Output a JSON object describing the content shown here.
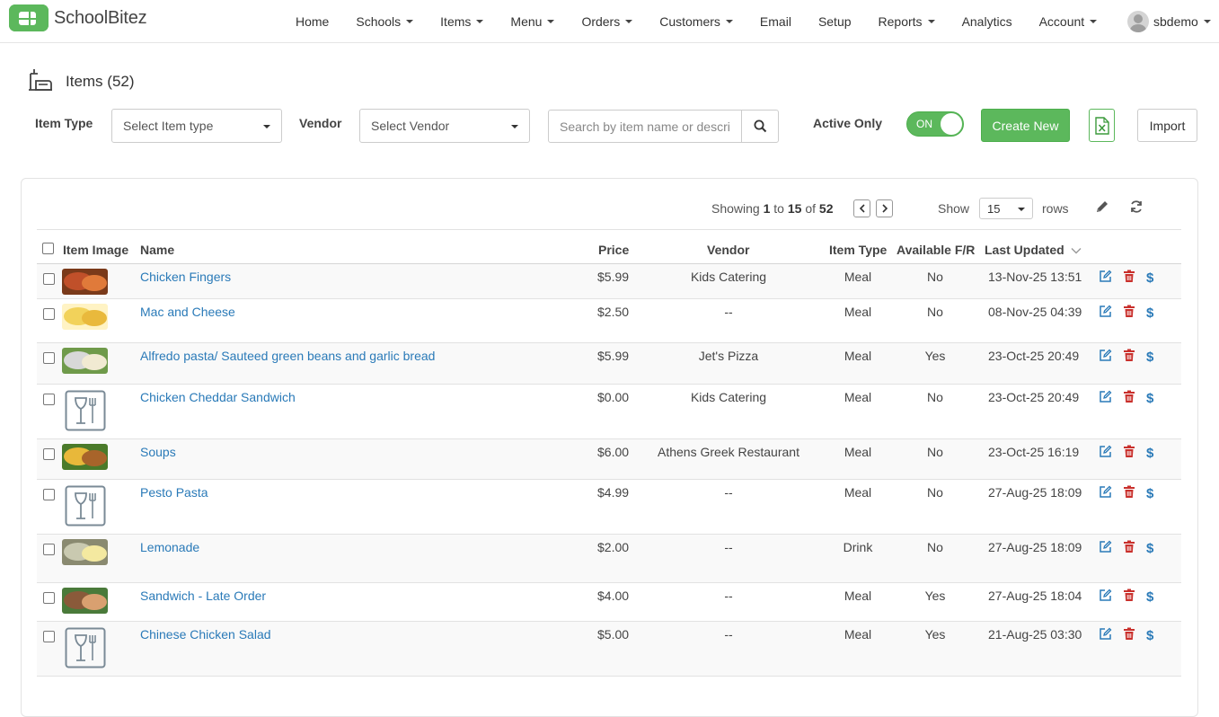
{
  "brand": {
    "name": "SchoolBitez",
    "color": "#5cb85c"
  },
  "nav": {
    "items": [
      {
        "label": "Home",
        "dropdown": false
      },
      {
        "label": "Schools",
        "dropdown": true
      },
      {
        "label": "Items",
        "dropdown": true
      },
      {
        "label": "Menu",
        "dropdown": true
      },
      {
        "label": "Orders",
        "dropdown": true
      },
      {
        "label": "Customers",
        "dropdown": true
      },
      {
        "label": "Email",
        "dropdown": false
      },
      {
        "label": "Setup",
        "dropdown": false
      },
      {
        "label": "Reports",
        "dropdown": true
      },
      {
        "label": "Analytics",
        "dropdown": false
      },
      {
        "label": "Account",
        "dropdown": true
      }
    ],
    "user": "sbdemo"
  },
  "page": {
    "title": "Items (52)",
    "icon": "food-tray-icon"
  },
  "filters": {
    "item_type_label": "Item Type",
    "item_type_value": "Select Item type",
    "vendor_label": "Vendor",
    "vendor_value": "Select Vendor",
    "search_placeholder": "Search by item name or description",
    "active_only_label": "Active Only",
    "toggle_text": "ON",
    "create_label": "Create New",
    "import_label": "Import"
  },
  "pager": {
    "showing_prefix": "Showing",
    "from": "1",
    "to_word": "to",
    "to": "15",
    "of_word": "of",
    "total": "52",
    "show_label": "Show",
    "rows_value": "15",
    "rows_label": "rows"
  },
  "table": {
    "headers": {
      "image": "Item Image",
      "name": "Name",
      "price": "Price",
      "vendor": "Vendor",
      "type": "Item Type",
      "available": "Available F/R",
      "updated": "Last Updated"
    },
    "rows": [
      {
        "name": "Chicken Fingers",
        "price": "$5.99",
        "vendor": "Kids Catering",
        "type": "Meal",
        "available": "No",
        "updated": "13-Nov-25 13:51",
        "image": "photo"
      },
      {
        "name": "Mac and Cheese",
        "price": "$2.50",
        "vendor": "--",
        "type": "Meal",
        "available": "No",
        "updated": "08-Nov-25 04:39",
        "image": "photo"
      },
      {
        "name": "Alfredo pasta/ Sauteed green beans and garlic bread",
        "price": "$5.99",
        "vendor": "Jet's Pizza",
        "type": "Meal",
        "available": "Yes",
        "updated": "23-Oct-25 20:49",
        "image": "photo"
      },
      {
        "name": "Chicken Cheddar Sandwich",
        "price": "$0.00",
        "vendor": "Kids Catering",
        "type": "Meal",
        "available": "No",
        "updated": "23-Oct-25 20:49",
        "image": "placeholder"
      },
      {
        "name": "Soups",
        "price": "$6.00",
        "vendor": "Athens Greek Restaurant",
        "type": "Meal",
        "available": "No",
        "updated": "23-Oct-25 16:19",
        "image": "photo"
      },
      {
        "name": "Pesto Pasta",
        "price": "$4.99",
        "vendor": "--",
        "type": "Meal",
        "available": "No",
        "updated": "27-Aug-25 18:09",
        "image": "placeholder"
      },
      {
        "name": "Lemonade",
        "price": "$2.00",
        "vendor": "--",
        "type": "Drink",
        "available": "No",
        "updated": "27-Aug-25 18:09",
        "image": "photo"
      },
      {
        "name": "Sandwich - Late Order",
        "price": "$4.00",
        "vendor": "--",
        "type": "Meal",
        "available": "Yes",
        "updated": "27-Aug-25 18:04",
        "image": "photo"
      },
      {
        "name": "Chinese Chicken Salad",
        "price": "$5.00",
        "vendor": "--",
        "type": "Meal",
        "available": "Yes",
        "updated": "21-Aug-25 03:30",
        "image": "placeholder"
      }
    ],
    "action_symbol": "$"
  },
  "colors": {
    "link": "#2a7ab8",
    "delete": "#c9302c",
    "green": "#5cb85c"
  }
}
